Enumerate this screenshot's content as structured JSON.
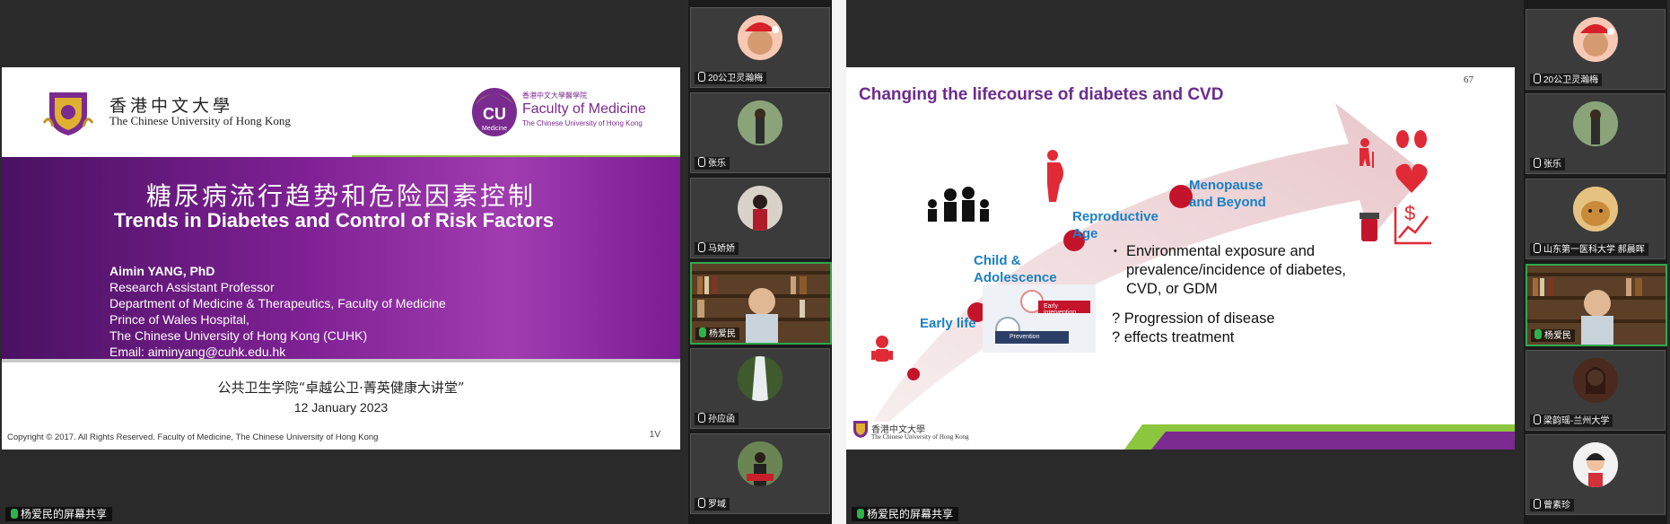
{
  "left_panel": {
    "slide": {
      "cuhk_name_cn": "香港中文大學",
      "cuhk_name_en": "The Chinese University of Hong Kong",
      "fom_name_cn": "香港中文大學醫學院",
      "fom_name": "Faculty of Medicine",
      "fom_sub": "The Chinese University of Hong Kong",
      "cu_logo_text": "CU",
      "cu_logo_sub": "Medicine",
      "title_cn": "糖尿病流行趋势和危险因素控制",
      "title_en": "Trends in Diabetes and Control of Risk Factors",
      "author_name": "Aimin YANG, PhD",
      "author_lines": [
        "Research Assistant Professor",
        "Department of Medicine & Therapeutics, Faculty of Medicine",
        "Prince of Wales Hospital,",
        "The Chinese University of Hong Kong (CUHK)",
        "Email: aiminyang@cuhk.edu.hk"
      ],
      "lecture": "公共卫生学院“卓越公卫·菁英健康大讲堂”",
      "date": "12 January 2023",
      "copyright": "Copyright © 2017. All Rights Reserved. Faculty of Medicine, The Chinese University of Hong Kong",
      "page_number": "1V"
    },
    "share_label": "杨爱民的屏幕共享",
    "participants": [
      {
        "name": "20公卫灵瀚梅"
      },
      {
        "name": "张乐"
      },
      {
        "name": "马娇娇"
      },
      {
        "name": "杨爱民"
      },
      {
        "name": "孙应函"
      },
      {
        "name": "罗域"
      }
    ]
  },
  "right_panel": {
    "slide": {
      "title": "Changing the lifecourse of diabetes and CVD",
      "page_number": "67",
      "stages": {
        "early_life": "Early life",
        "child_1": "Child &",
        "child_2": "Adolescence",
        "repro_1": "Reproductive",
        "repro_2": "Age",
        "meno_1": "Menopause",
        "meno_2": "and Beyond"
      },
      "bullet_lines": [
        "Environmental exposure and",
        "prevalence/incidence of diabetes,",
        "CVD, or GDM"
      ],
      "questions": [
        "? Progression of disease",
        "? effects treatment"
      ],
      "inset_labels": {
        "early_intervention": "Early intervention",
        "prevention": "Prevention"
      },
      "footer_cn": "香港中文大學",
      "footer_en": "The Chinese University of Hong Kong"
    },
    "share_label": "杨爱民的屏幕共享",
    "participants": [
      {
        "name": "20公卫灵瀚梅"
      },
      {
        "name": "张乐"
      },
      {
        "name": "山东第一医科大学 郝晨晖"
      },
      {
        "name": "杨爱民"
      },
      {
        "name": "梁韵瑶-兰州大学"
      },
      {
        "name": "曾素珍"
      }
    ]
  },
  "colors": {
    "banner_purple": "#7f2194",
    "slide_title_purple": "#6c2c8e",
    "stage_blue": "#1a80c4",
    "dot_red": "#c4142b",
    "accent_green": "#8cc63f",
    "speaking_green": "#2fa84f"
  }
}
